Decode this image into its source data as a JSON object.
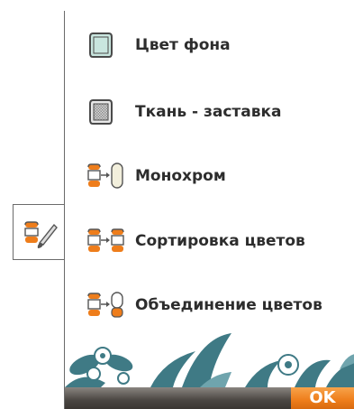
{
  "menu": {
    "items": [
      {
        "label": "Цвет фона",
        "icon": "background-color-icon"
      },
      {
        "label": "Ткань - заставка",
        "icon": "fabric-texture-icon"
      },
      {
        "label": "Монохром",
        "icon": "monochrome-icon"
      },
      {
        "label": "Сортировка цветов",
        "icon": "sort-colors-icon"
      },
      {
        "label": "Объединение цветов",
        "icon": "merge-colors-icon"
      }
    ]
  },
  "side_tab": {
    "icon": "color-brush-icon"
  },
  "footer": {
    "ok_label": "OK"
  },
  "colors": {
    "accent_orange": "#ee7d1b",
    "icon_teal": "#c9e6df",
    "deco_teal": "#3f7a85"
  }
}
